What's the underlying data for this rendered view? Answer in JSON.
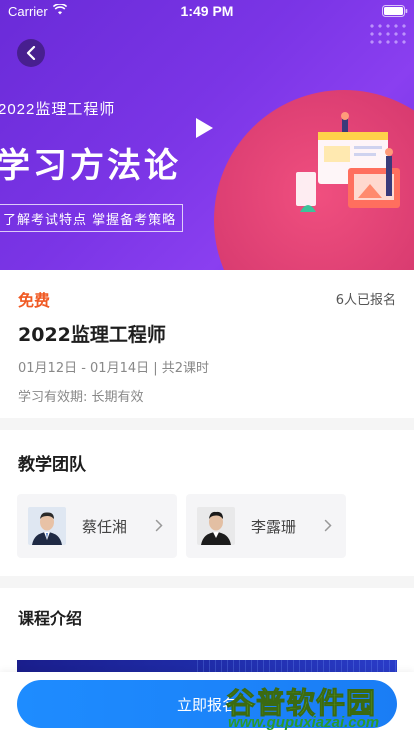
{
  "status_bar": {
    "carrier": "Carrier",
    "time": "1:49 PM"
  },
  "banner": {
    "year_title": "2022监理工程师",
    "main_title": "学习方法论",
    "slogan": "了解考试特点 掌握备考策略"
  },
  "course": {
    "price": "免费",
    "enrolled": "6人已报名",
    "title": "2022监理工程师",
    "schedule": "01月12日 - 01月14日 | 共2课时",
    "validity": "学习有效期: 长期有效"
  },
  "team": {
    "title": "教学团队",
    "teachers": [
      {
        "name": "蔡任湘"
      },
      {
        "name": "李露珊"
      }
    ]
  },
  "intro": {
    "title": "课程介绍"
  },
  "actions": {
    "enroll_label": "立即报名"
  },
  "watermark": {
    "name": "谷普软件园",
    "url": "www.gupuxiazai.com"
  },
  "colors": {
    "accent_orange": "#f05a24",
    "primary_blue": "#1e8cff",
    "banner_purple": "#7b35e6"
  }
}
